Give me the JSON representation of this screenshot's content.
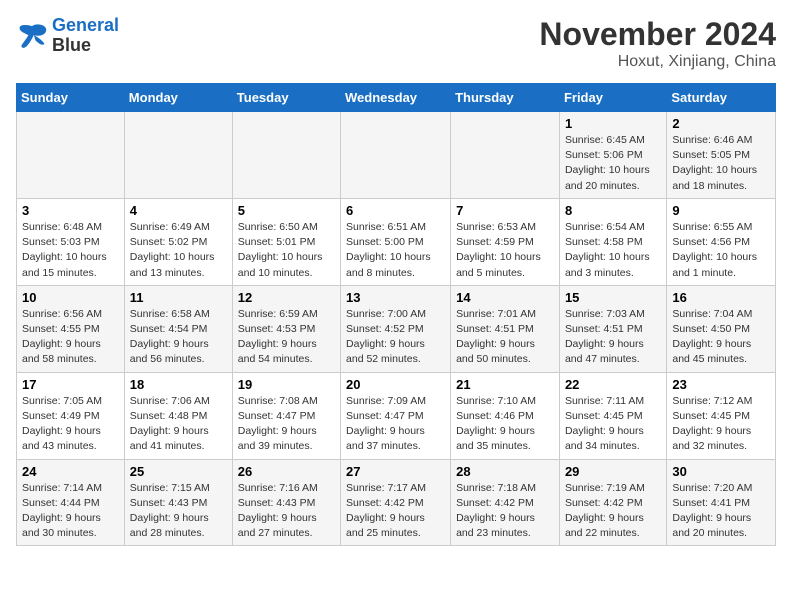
{
  "logo": {
    "line1": "General",
    "line2": "Blue"
  },
  "title": "November 2024",
  "subtitle": "Hoxut, Xinjiang, China",
  "days_of_week": [
    "Sunday",
    "Monday",
    "Tuesday",
    "Wednesday",
    "Thursday",
    "Friday",
    "Saturday"
  ],
  "weeks": [
    [
      {
        "day": "",
        "info": ""
      },
      {
        "day": "",
        "info": ""
      },
      {
        "day": "",
        "info": ""
      },
      {
        "day": "",
        "info": ""
      },
      {
        "day": "",
        "info": ""
      },
      {
        "day": "1",
        "info": "Sunrise: 6:45 AM\nSunset: 5:06 PM\nDaylight: 10 hours and 20 minutes."
      },
      {
        "day": "2",
        "info": "Sunrise: 6:46 AM\nSunset: 5:05 PM\nDaylight: 10 hours and 18 minutes."
      }
    ],
    [
      {
        "day": "3",
        "info": "Sunrise: 6:48 AM\nSunset: 5:03 PM\nDaylight: 10 hours and 15 minutes."
      },
      {
        "day": "4",
        "info": "Sunrise: 6:49 AM\nSunset: 5:02 PM\nDaylight: 10 hours and 13 minutes."
      },
      {
        "day": "5",
        "info": "Sunrise: 6:50 AM\nSunset: 5:01 PM\nDaylight: 10 hours and 10 minutes."
      },
      {
        "day": "6",
        "info": "Sunrise: 6:51 AM\nSunset: 5:00 PM\nDaylight: 10 hours and 8 minutes."
      },
      {
        "day": "7",
        "info": "Sunrise: 6:53 AM\nSunset: 4:59 PM\nDaylight: 10 hours and 5 minutes."
      },
      {
        "day": "8",
        "info": "Sunrise: 6:54 AM\nSunset: 4:58 PM\nDaylight: 10 hours and 3 minutes."
      },
      {
        "day": "9",
        "info": "Sunrise: 6:55 AM\nSunset: 4:56 PM\nDaylight: 10 hours and 1 minute."
      }
    ],
    [
      {
        "day": "10",
        "info": "Sunrise: 6:56 AM\nSunset: 4:55 PM\nDaylight: 9 hours and 58 minutes."
      },
      {
        "day": "11",
        "info": "Sunrise: 6:58 AM\nSunset: 4:54 PM\nDaylight: 9 hours and 56 minutes."
      },
      {
        "day": "12",
        "info": "Sunrise: 6:59 AM\nSunset: 4:53 PM\nDaylight: 9 hours and 54 minutes."
      },
      {
        "day": "13",
        "info": "Sunrise: 7:00 AM\nSunset: 4:52 PM\nDaylight: 9 hours and 52 minutes."
      },
      {
        "day": "14",
        "info": "Sunrise: 7:01 AM\nSunset: 4:51 PM\nDaylight: 9 hours and 50 minutes."
      },
      {
        "day": "15",
        "info": "Sunrise: 7:03 AM\nSunset: 4:51 PM\nDaylight: 9 hours and 47 minutes."
      },
      {
        "day": "16",
        "info": "Sunrise: 7:04 AM\nSunset: 4:50 PM\nDaylight: 9 hours and 45 minutes."
      }
    ],
    [
      {
        "day": "17",
        "info": "Sunrise: 7:05 AM\nSunset: 4:49 PM\nDaylight: 9 hours and 43 minutes."
      },
      {
        "day": "18",
        "info": "Sunrise: 7:06 AM\nSunset: 4:48 PM\nDaylight: 9 hours and 41 minutes."
      },
      {
        "day": "19",
        "info": "Sunrise: 7:08 AM\nSunset: 4:47 PM\nDaylight: 9 hours and 39 minutes."
      },
      {
        "day": "20",
        "info": "Sunrise: 7:09 AM\nSunset: 4:47 PM\nDaylight: 9 hours and 37 minutes."
      },
      {
        "day": "21",
        "info": "Sunrise: 7:10 AM\nSunset: 4:46 PM\nDaylight: 9 hours and 35 minutes."
      },
      {
        "day": "22",
        "info": "Sunrise: 7:11 AM\nSunset: 4:45 PM\nDaylight: 9 hours and 34 minutes."
      },
      {
        "day": "23",
        "info": "Sunrise: 7:12 AM\nSunset: 4:45 PM\nDaylight: 9 hours and 32 minutes."
      }
    ],
    [
      {
        "day": "24",
        "info": "Sunrise: 7:14 AM\nSunset: 4:44 PM\nDaylight: 9 hours and 30 minutes."
      },
      {
        "day": "25",
        "info": "Sunrise: 7:15 AM\nSunset: 4:43 PM\nDaylight: 9 hours and 28 minutes."
      },
      {
        "day": "26",
        "info": "Sunrise: 7:16 AM\nSunset: 4:43 PM\nDaylight: 9 hours and 27 minutes."
      },
      {
        "day": "27",
        "info": "Sunrise: 7:17 AM\nSunset: 4:42 PM\nDaylight: 9 hours and 25 minutes."
      },
      {
        "day": "28",
        "info": "Sunrise: 7:18 AM\nSunset: 4:42 PM\nDaylight: 9 hours and 23 minutes."
      },
      {
        "day": "29",
        "info": "Sunrise: 7:19 AM\nSunset: 4:42 PM\nDaylight: 9 hours and 22 minutes."
      },
      {
        "day": "30",
        "info": "Sunrise: 7:20 AM\nSunset: 4:41 PM\nDaylight: 9 hours and 20 minutes."
      }
    ]
  ]
}
